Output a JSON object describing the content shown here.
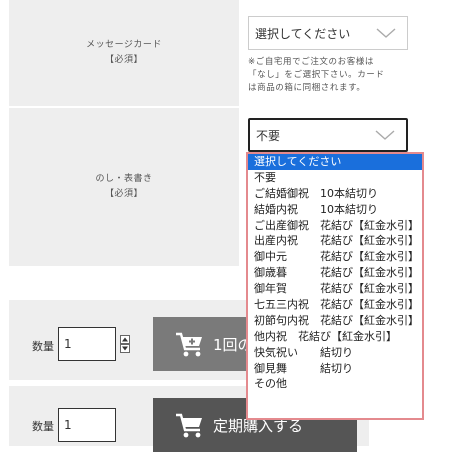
{
  "message_card": {
    "title": "メッセージカード",
    "required": "【必須】"
  },
  "noshi": {
    "title": "のし・表書き",
    "required": "【必須】"
  },
  "card_select": {
    "value": "選択してください"
  },
  "card_note": {
    "line1": "※ご自宅用でご注文のお客様は",
    "line2": "「なし」をご選択下さい。カード",
    "line3": "は商品の箱に同梱されます。"
  },
  "noshi_select": {
    "value": "不要"
  },
  "noshi_options": [
    "選択してください",
    "不要",
    "ご結婚御祝　10本結切り",
    "結婚内祝　　10本結切り",
    "ご出産御祝　花結び【紅金水引】",
    "出産内祝　　花結び【紅金水引】",
    "御中元　　　花結び【紅金水引】",
    "御歳暮　　　花結び【紅金水引】",
    "御年賀　　　花結び【紅金水引】",
    "七五三内祝　花結び【紅金水引】",
    "初節句内祝　花結び【紅金水引】",
    "他内祝　花結び【紅金水引】",
    "快気祝い　　結切り",
    "御見舞　　　結切り",
    "その他"
  ],
  "purchase": [
    {
      "qty_label": "数量",
      "qty_value": "1",
      "button_label": "1回の"
    },
    {
      "qty_label": "数量",
      "qty_value": "1",
      "button_label": "定期購入する"
    }
  ],
  "colors": {
    "dropdown_border": "#e48a8e",
    "selected_bg": "#1a6fdc",
    "label_bg": "#eeeeee",
    "button_gray": "#7a7a7a",
    "button_dark": "#555555"
  },
  "icons": {
    "chevron": "chevron-down-icon",
    "cart": "cart-plus-icon",
    "spinner": "stepper-icon"
  }
}
